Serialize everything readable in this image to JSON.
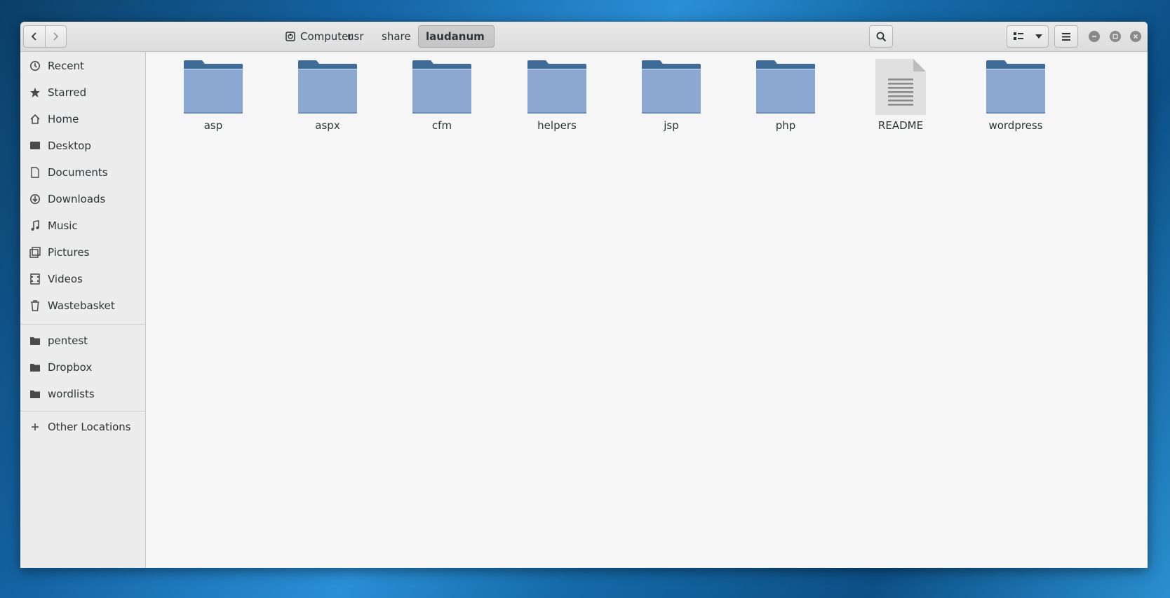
{
  "colors": {
    "folder_front": "#8aa8d0",
    "folder_back": "#3e6b97",
    "accent": "#2a8fd6"
  },
  "breadcrumb": {
    "items": [
      {
        "label": "Computer",
        "icon": "drive-icon"
      },
      {
        "label": "usr"
      },
      {
        "label": "share"
      },
      {
        "label": "laudanum",
        "active": true
      }
    ]
  },
  "sidebar": {
    "places": [
      {
        "label": "Recent",
        "icon": "clock-icon"
      },
      {
        "label": "Starred",
        "icon": "star-icon"
      },
      {
        "label": "Home",
        "icon": "home-icon"
      },
      {
        "label": "Desktop",
        "icon": "desktop-icon"
      },
      {
        "label": "Documents",
        "icon": "document-icon"
      },
      {
        "label": "Downloads",
        "icon": "download-icon"
      },
      {
        "label": "Music",
        "icon": "music-icon"
      },
      {
        "label": "Pictures",
        "icon": "picture-icon"
      },
      {
        "label": "Videos",
        "icon": "video-icon"
      },
      {
        "label": "Wastebasket",
        "icon": "trash-icon"
      }
    ],
    "bookmarks": [
      {
        "label": "pentest",
        "icon": "folder-icon"
      },
      {
        "label": "Dropbox",
        "icon": "folder-icon"
      },
      {
        "label": "wordlists",
        "icon": "folder-icon"
      }
    ],
    "other": {
      "label": "Other Locations",
      "icon": "plus-icon"
    }
  },
  "files": [
    {
      "name": "asp",
      "type": "folder"
    },
    {
      "name": "aspx",
      "type": "folder"
    },
    {
      "name": "cfm",
      "type": "folder"
    },
    {
      "name": "helpers",
      "type": "folder"
    },
    {
      "name": "jsp",
      "type": "folder"
    },
    {
      "name": "php",
      "type": "folder"
    },
    {
      "name": "README",
      "type": "text-file"
    },
    {
      "name": "wordpress",
      "type": "folder"
    }
  ]
}
